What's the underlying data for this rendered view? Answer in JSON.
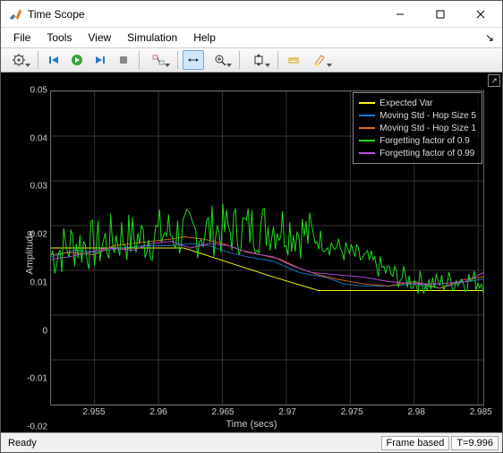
{
  "window": {
    "title": "Time Scope"
  },
  "menu": {
    "file": "File",
    "tools": "Tools",
    "view": "View",
    "simulation": "Simulation",
    "help": "Help"
  },
  "status": {
    "ready": "Ready",
    "mode": "Frame based",
    "time": "T=9.996"
  },
  "chart_data": {
    "type": "line",
    "title": "",
    "xlabel": "Time (secs)",
    "ylabel": "Amplitude",
    "xlim": [
      2.9516,
      2.9854
    ],
    "ylim": [
      -0.02,
      0.05
    ],
    "xticks": [
      2.955,
      2.96,
      2.965,
      2.97,
      2.975,
      2.98,
      2.985
    ],
    "yticks": [
      -0.02,
      -0.01,
      0,
      0.01,
      0.02,
      0.03,
      0.04,
      0.05
    ],
    "series": [
      {
        "name": "Expected Var",
        "color": "#f5f50a",
        "x": [
          2.9516,
          2.956,
          2.962,
          2.969,
          2.9725,
          2.9854
        ],
        "y": [
          0.015,
          0.015,
          0.015,
          0.0085,
          0.0055,
          0.0055
        ]
      },
      {
        "name": "Moving Std - Hop Size 5",
        "color": "#1875d1",
        "x": [
          2.9516,
          2.9535,
          2.955,
          2.957,
          2.959,
          2.961,
          2.9625,
          2.964,
          2.9655,
          2.967,
          2.969,
          2.971,
          2.973,
          2.9745,
          2.976,
          2.978,
          2.98,
          2.982,
          2.984,
          2.9854
        ],
        "y": [
          0.013,
          0.0145,
          0.014,
          0.015,
          0.0155,
          0.0155,
          0.016,
          0.0155,
          0.014,
          0.013,
          0.012,
          0.0095,
          0.0085,
          0.007,
          0.0065,
          0.0065,
          0.007,
          0.006,
          0.0075,
          0.008
        ]
      },
      {
        "name": "Moving Std - Hop Size 1",
        "color": "#e06a1a",
        "x": [
          2.9516,
          2.953,
          2.955,
          2.9565,
          2.958,
          2.9595,
          2.961,
          2.962,
          2.9635,
          2.965,
          2.9665,
          2.968,
          2.9695,
          2.971,
          2.9725,
          2.974,
          2.976,
          2.978,
          2.98,
          2.982,
          2.984,
          2.9854
        ],
        "y": [
          0.0135,
          0.014,
          0.0135,
          0.0155,
          0.016,
          0.0165,
          0.017,
          0.0175,
          0.017,
          0.016,
          0.0145,
          0.0135,
          0.0125,
          0.0105,
          0.009,
          0.008,
          0.007,
          0.0065,
          0.0075,
          0.006,
          0.008,
          0.0085
        ]
      },
      {
        "name": "Forgetting factor of 0.9",
        "color": "#1edc1e",
        "noise": true,
        "x": [
          2.9516,
          2.9854
        ],
        "y_base": [
          0.0135,
          0.016,
          0.0155,
          0.0175,
          0.017,
          0.0185,
          0.018,
          0.019,
          0.019,
          0.0195,
          0.02,
          0.0185,
          0.0165,
          0.014,
          0.012,
          0.009,
          0.0075,
          0.007,
          0.008,
          0.0075
        ],
        "noise_amp": 0.012
      },
      {
        "name": "Forgetting factor of 0.99",
        "color": "#b84ae0",
        "x": [
          2.9516,
          2.953,
          2.9545,
          2.956,
          2.958,
          2.9595,
          2.961,
          2.9625,
          2.964,
          2.9655,
          2.967,
          2.969,
          2.9705,
          2.972,
          2.974,
          2.976,
          2.978,
          2.98,
          2.982,
          2.984,
          2.9854
        ],
        "y": [
          0.0125,
          0.013,
          0.014,
          0.015,
          0.0145,
          0.016,
          0.0165,
          0.015,
          0.016,
          0.0155,
          0.014,
          0.013,
          0.011,
          0.0095,
          0.009,
          0.0085,
          0.0075,
          0.007,
          0.007,
          0.0075,
          0.0095
        ]
      }
    ]
  }
}
